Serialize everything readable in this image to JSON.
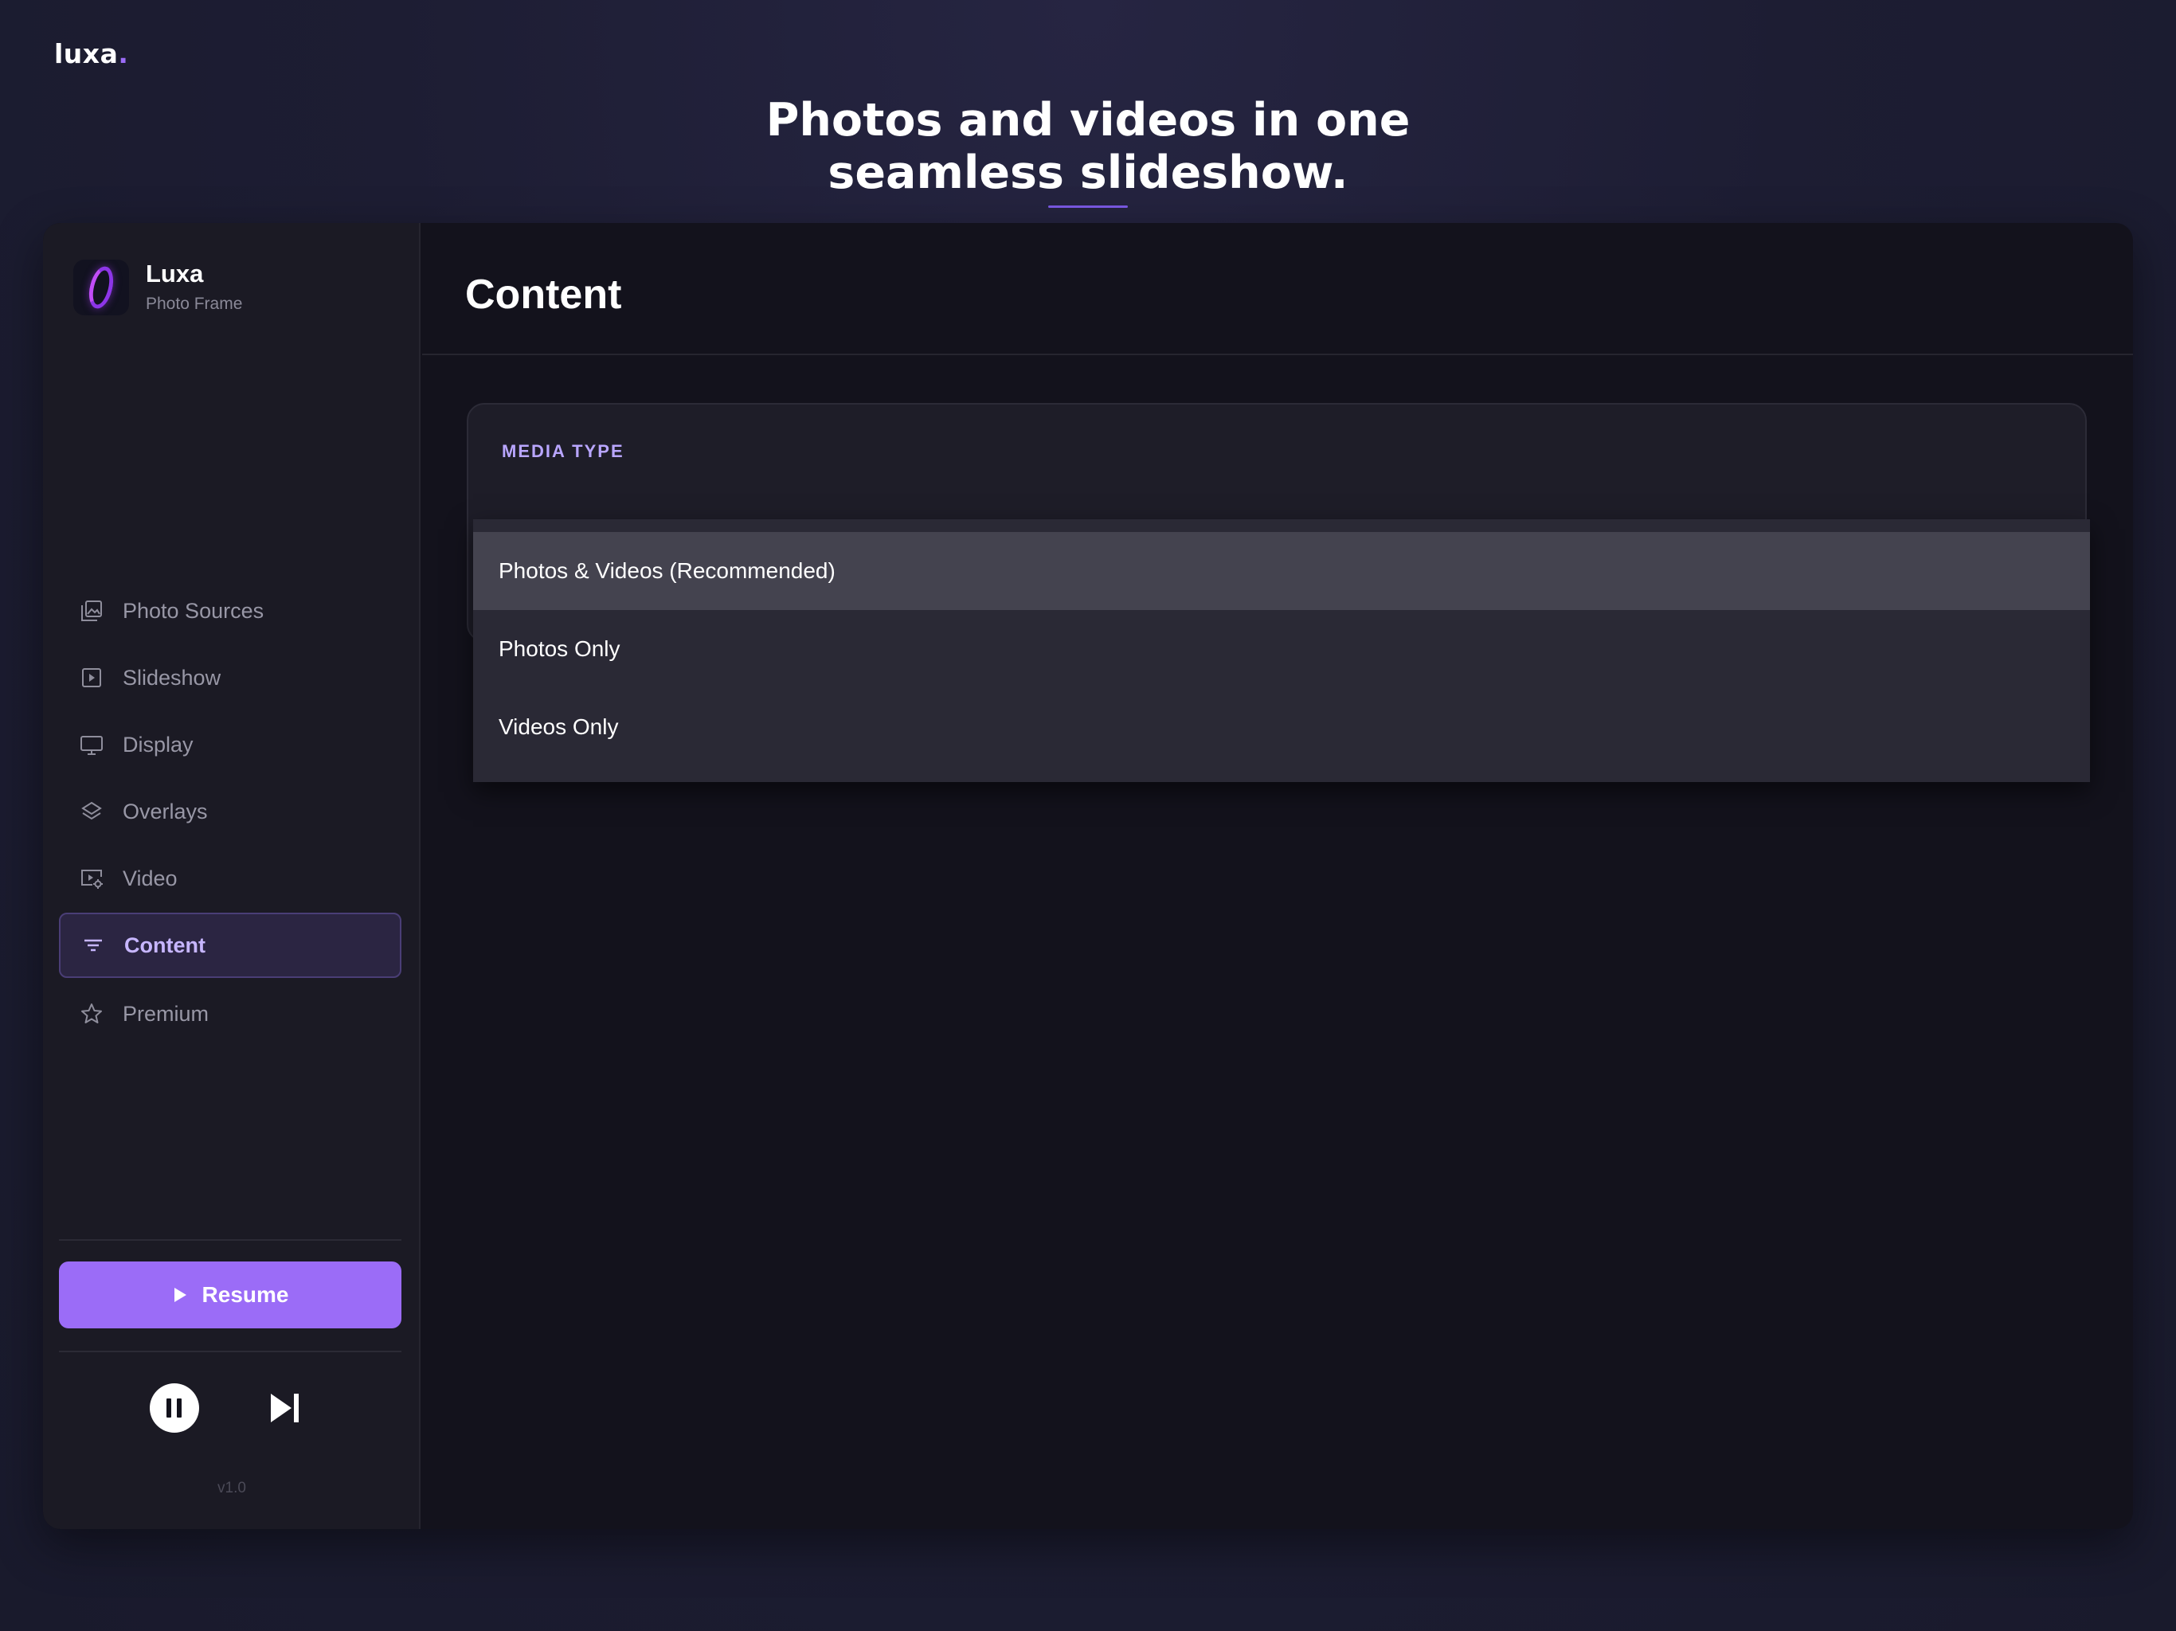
{
  "page": {
    "brand": "luxa",
    "brand_dot": ".",
    "headline_line1": "Photos and videos in one",
    "headline_line2": "seamless slideshow."
  },
  "sidebar": {
    "app_name": "Luxa",
    "app_subtitle": "Photo Frame",
    "items": [
      {
        "label": "Photo Sources",
        "icon": "photo-library-icon",
        "active": false
      },
      {
        "label": "Slideshow",
        "icon": "slideshow-icon",
        "active": false
      },
      {
        "label": "Display",
        "icon": "monitor-icon",
        "active": false
      },
      {
        "label": "Overlays",
        "icon": "layers-icon",
        "active": false
      },
      {
        "label": "Video",
        "icon": "video-settings-icon",
        "active": false
      },
      {
        "label": "Content",
        "icon": "filter-icon",
        "active": true
      },
      {
        "label": "Premium",
        "icon": "star-icon",
        "active": false
      }
    ],
    "resume_label": "Resume",
    "version": "v1.0"
  },
  "main": {
    "title": "Content",
    "media_type_label": "MEDIA TYPE",
    "dropdown": {
      "options": [
        "Photos & Videos (Recommended)",
        "Photos Only",
        "Videos Only"
      ],
      "selected": "Photos & Videos (Recommended)"
    }
  },
  "colors": {
    "accent": "#9b6cf7",
    "background": "#1d1d33",
    "panel": "#13121c",
    "sidebar": "#1b1a24",
    "active_nav_text": "#c7b6ff"
  }
}
